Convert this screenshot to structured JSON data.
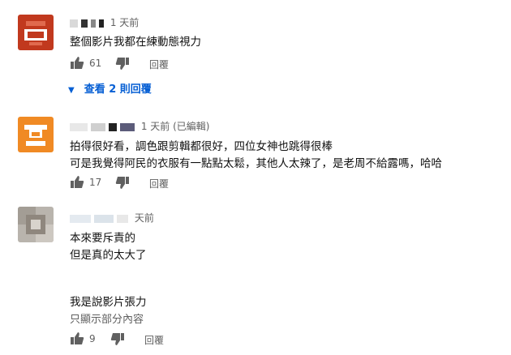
{
  "comments": [
    {
      "timestamp": "1 天前",
      "lines": [
        "整個影片我都在練動態視力"
      ],
      "likes": "61",
      "reply_label": "回覆",
      "view_replies": "查看 2 則回覆"
    },
    {
      "timestamp": "1 天前 (已編輯)",
      "lines": [
        "拍得很好看，調色跟剪輯都很好，四位女神也跳得很棒",
        "可是我覺得阿民的衣服有一點點太鬆，其他人太辣了，是老周不給露嗎，哈哈"
      ],
      "likes": "17",
      "reply_label": "回覆"
    },
    {
      "timestamp": "天前",
      "lines": [
        "本來要斥責的",
        "但是真的太大了",
        "我是說影片張力"
      ],
      "show_more": "只顯示部分內容",
      "likes": "9",
      "reply_label": "回覆"
    }
  ],
  "colors": {
    "avatar1": "#c1391e",
    "avatar2": "#f08a24",
    "link": "#065fd4"
  },
  "icons": [
    "thumb-up-icon",
    "thumb-down-icon",
    "caret-down-icon"
  ]
}
